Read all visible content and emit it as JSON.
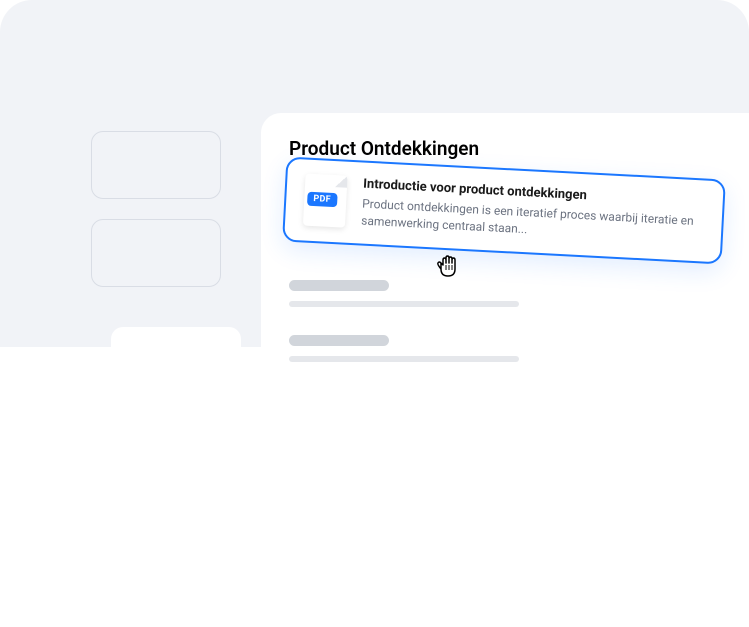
{
  "main": {
    "title": "Product Ontdekkingen"
  },
  "document": {
    "badge": "PDF",
    "title": "Introductie voor product ontdekkingen",
    "description": "Product ontdekkingen is een iteratief proces waarbij iteratie en samenwerking centraal staan..."
  }
}
